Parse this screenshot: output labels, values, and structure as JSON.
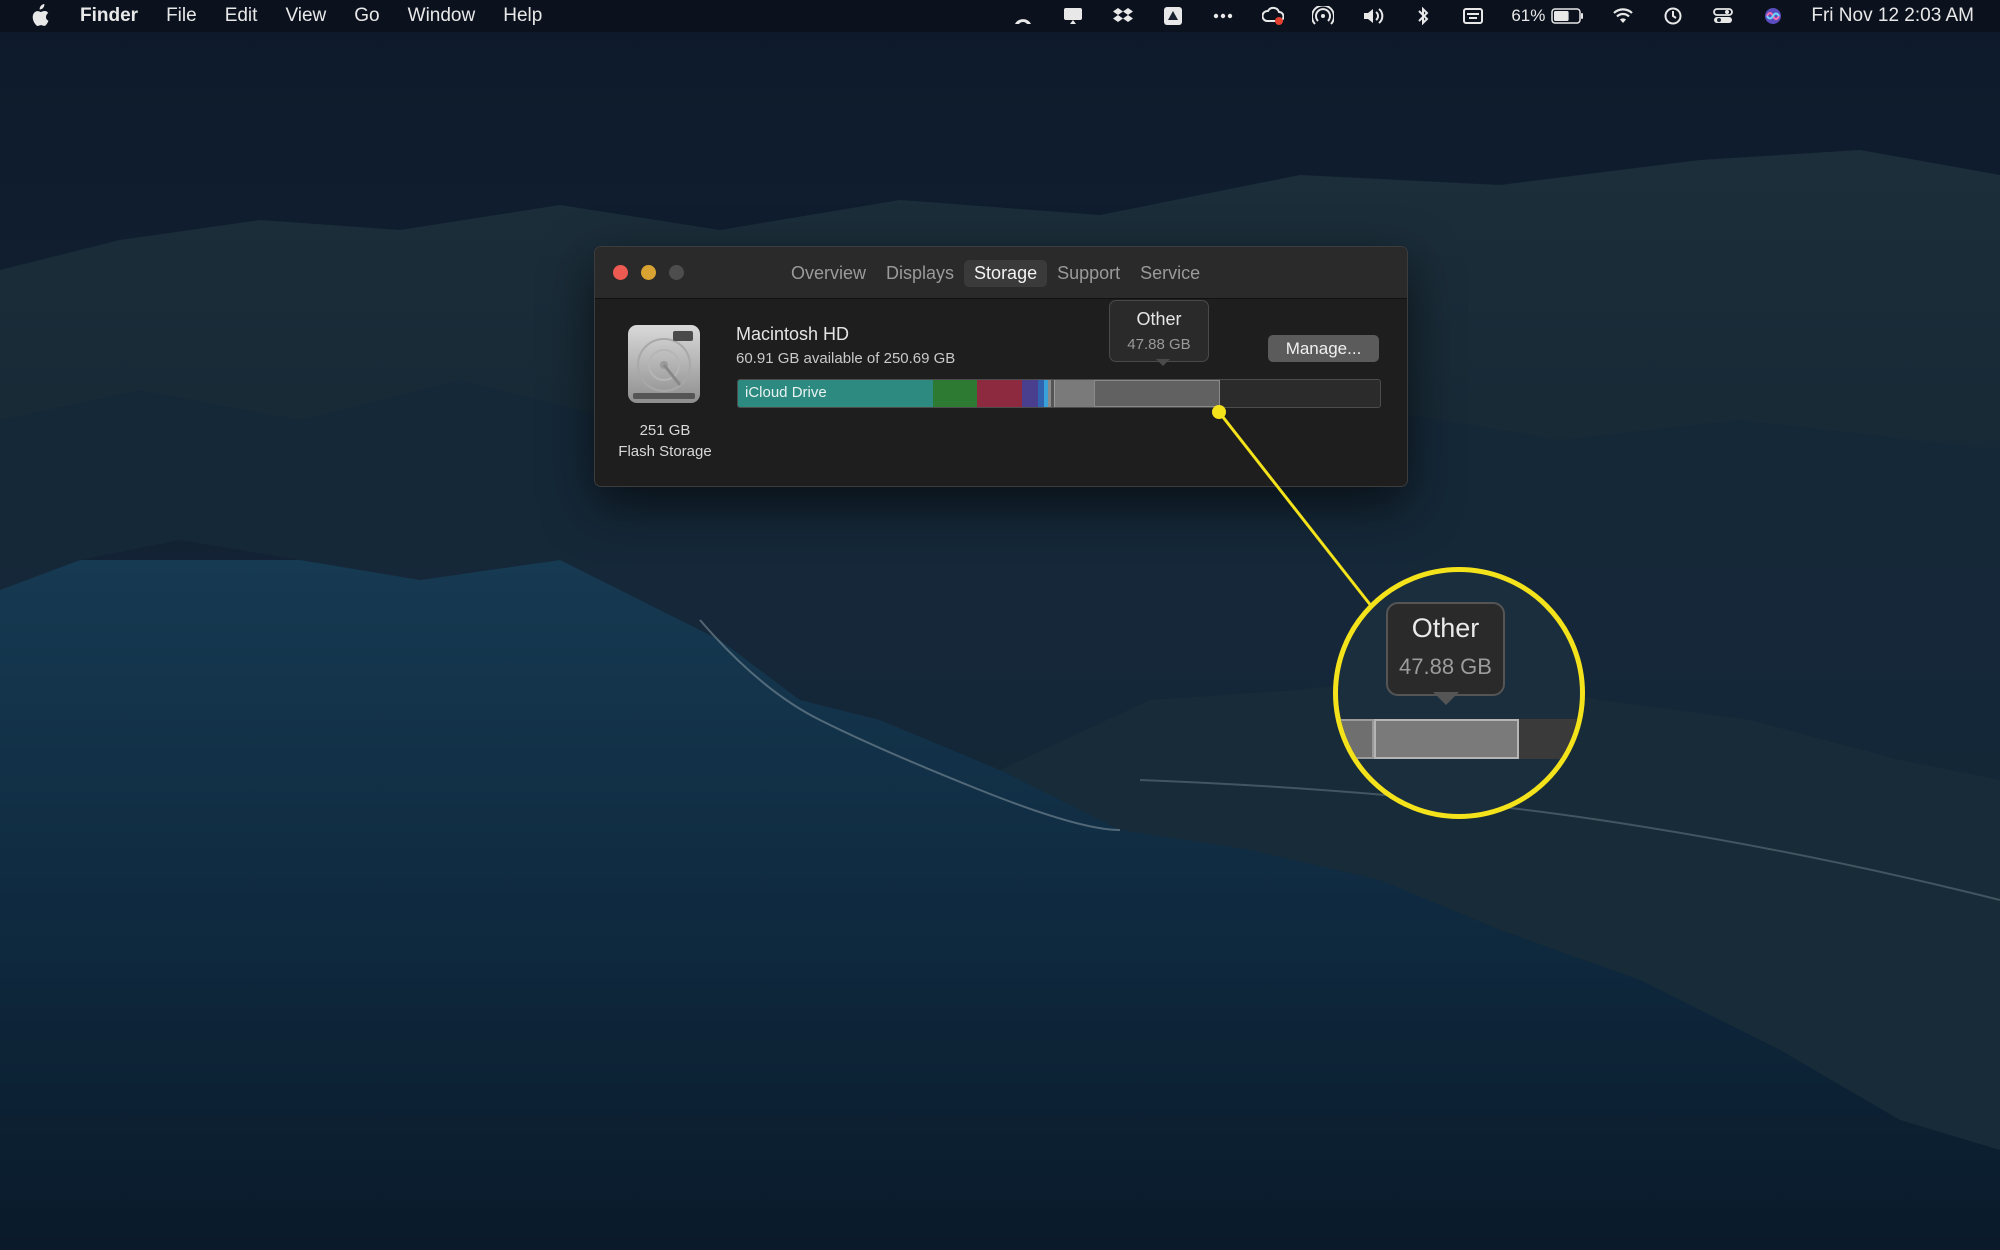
{
  "menubar": {
    "apple_icon": "apple-logo-icon",
    "app_name": "Finder",
    "menus": [
      "File",
      "Edit",
      "View",
      "Go",
      "Window",
      "Help"
    ],
    "status_icons": [
      "airplay-arc-icon",
      "display-icon",
      "dropbox-icon",
      "drive-icon",
      "more-dots-icon",
      "creative-cloud-icon",
      "airdrop-icon",
      "volume-icon",
      "bluetooth-icon",
      "keyboard-icon"
    ],
    "battery_percent": "61%",
    "battery_level": 0.61,
    "trailing_icons": [
      "wifi-icon",
      "time-machine-icon",
      "control-center-icon",
      "siri-icon"
    ],
    "clock": "Fri Nov 12  2:03 AM"
  },
  "window": {
    "tabs": [
      "Overview",
      "Displays",
      "Storage",
      "Support",
      "Service"
    ],
    "selected_tab": "Storage",
    "disk": {
      "icon": "hard-drive-icon",
      "size": "251 GB",
      "type": "Flash Storage"
    },
    "volume": {
      "name": "Macintosh HD",
      "available": "60.91 GB available of 250.69 GB"
    },
    "manage_label": "Manage...",
    "storage_bar": {
      "first_label": "iCloud Drive",
      "colors": {
        "icloud": "#2c8a80",
        "apps": "#2d7a33",
        "documents": "#8e2a40",
        "other": "#616161",
        "free": "#2b2b2b"
      }
    },
    "tooltip": {
      "title": "Other",
      "value": "47.88 GB"
    }
  },
  "callout": {
    "color": "#f4e21b",
    "title": "Other",
    "value": "47.88 GB"
  }
}
